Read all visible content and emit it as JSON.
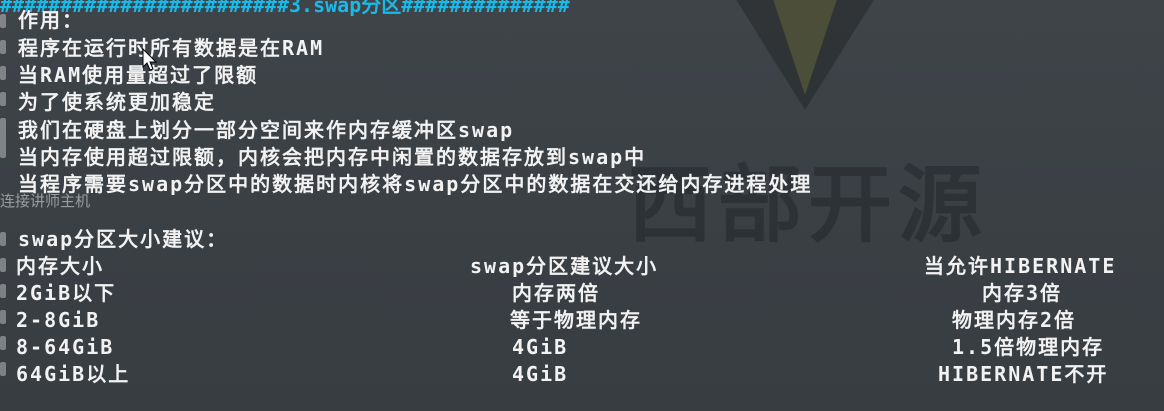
{
  "header": {
    "title_fragment": "########################3.swap分区##############"
  },
  "watermark": {
    "brand_text": "西部开源",
    "host_text": "连接讲师主机"
  },
  "content": {
    "usage_heading": "作用：",
    "lines": [
      "程序在运行时所有数据是在RAM",
      "当RAM使用量超过了限额",
      "为了使系统更加稳定",
      "我们在硬盘上划分一部分空间来作内存缓冲区swap",
      "当内存使用超过限额，内核会把内存中闲置的数据存放到swap中",
      "当程序需要swap分区中的数据时内核将swap分区中的数据在交还给内存进程处理"
    ],
    "size_heading": "swap分区大小建议："
  },
  "table": {
    "headers": [
      "内存大小",
      "swap分区建议大小",
      "当允许HIBERNATE"
    ],
    "rows": [
      [
        "2GiB以下",
        "内存两倍",
        "内存3倍"
      ],
      [
        "2-8GiB",
        "等于物理内存",
        "物理内存2倍"
      ],
      [
        "8-64GiB",
        "4GiB",
        "1.5倍物理内存"
      ],
      [
        "64GiB以上",
        "4GiB",
        "HIBERNATE不开"
      ]
    ]
  }
}
